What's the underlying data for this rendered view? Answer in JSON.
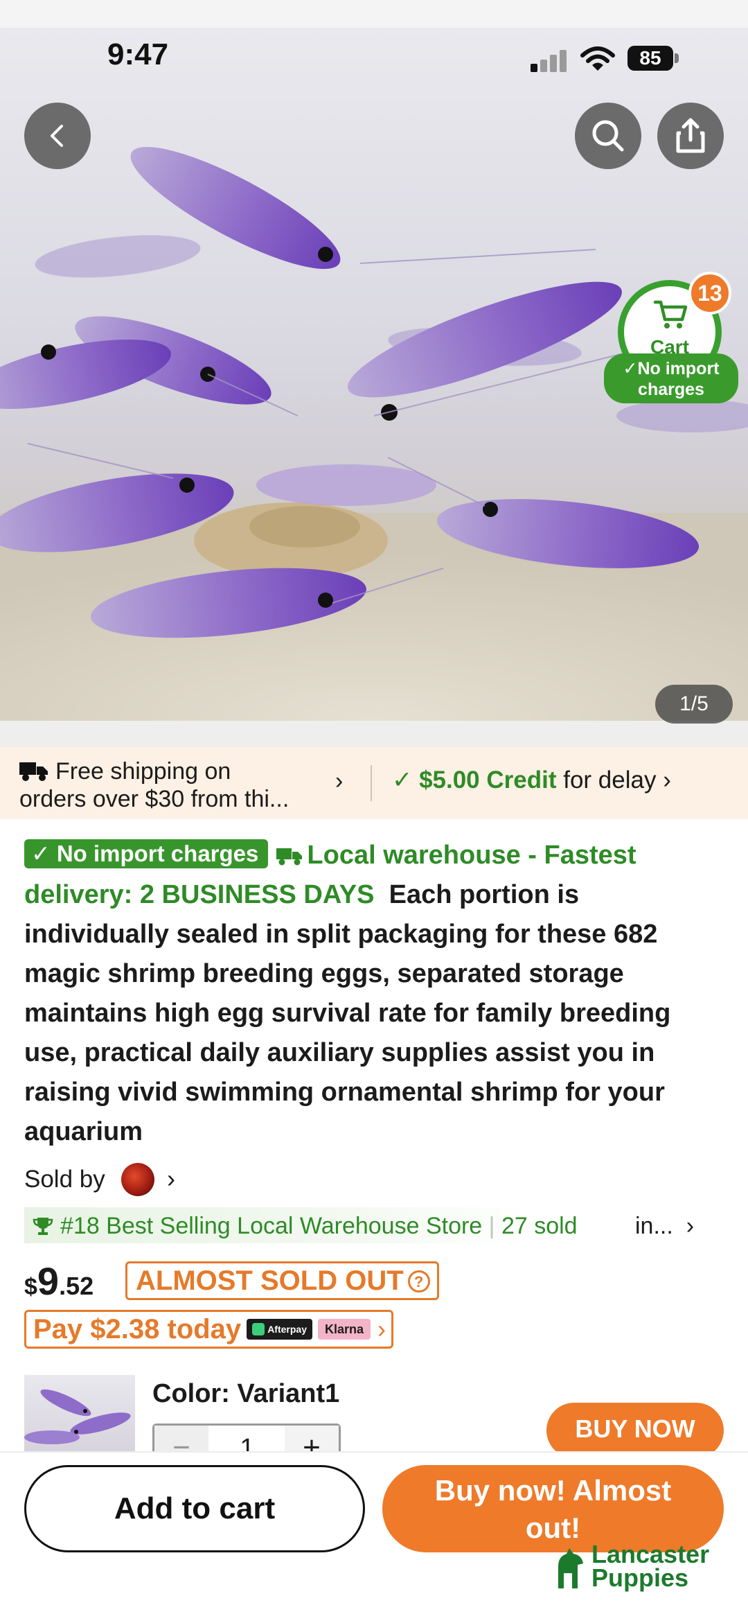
{
  "status": {
    "time": "9:47",
    "battery": "85"
  },
  "gallery": {
    "counter": "1/5"
  },
  "cart": {
    "label": "Cart",
    "count": "13",
    "badge_line1": "No import",
    "badge_line2": "charges"
  },
  "shipping": {
    "free_line1": "Free shipping on",
    "free_line2": "orders over $30 from thi...",
    "credit_amount": "$5.00 Credit",
    "credit_rest": "for delay"
  },
  "description": {
    "badge": "No import charges",
    "local": "Local warehouse - Fastest delivery: 2 BUSINESS DAYS",
    "text": "Each portion is individually sealed in split packaging for these 682 magic shrimp breeding eggs, separated storage maintains high egg survival rate for family breeding use, practical daily auxiliary supplies assist you in raising vivid swimming ornamental shrimp for your aquarium"
  },
  "seller": {
    "label": "Sold by"
  },
  "ranking": {
    "rank": "#18 Best Selling Local Warehouse Store",
    "sold": "27 sold",
    "more": "in..."
  },
  "price": {
    "currency": "$",
    "integer": "9",
    "decimal": ".52",
    "urgency": "ALMOST SOLD OUT"
  },
  "installment": {
    "text": "Pay $2.38 today",
    "afterpay": "Afterpay",
    "klarna": "Klarna"
  },
  "variant": {
    "label": "Color: Variant1",
    "quantity": "1",
    "minus": "−",
    "plus": "+",
    "buy_now": "BUY NOW"
  },
  "actions": {
    "add_to_cart": "Add to cart",
    "buy_now_line1": "Buy now! Almost",
    "buy_now_line2": "out!"
  },
  "watermark": {
    "line1": "Lancaster",
    "line2": "Puppies"
  },
  "colors": {
    "accent_orange": "#ee7a2a",
    "green": "#38952c",
    "ship_bg": "#fdf0e4"
  }
}
